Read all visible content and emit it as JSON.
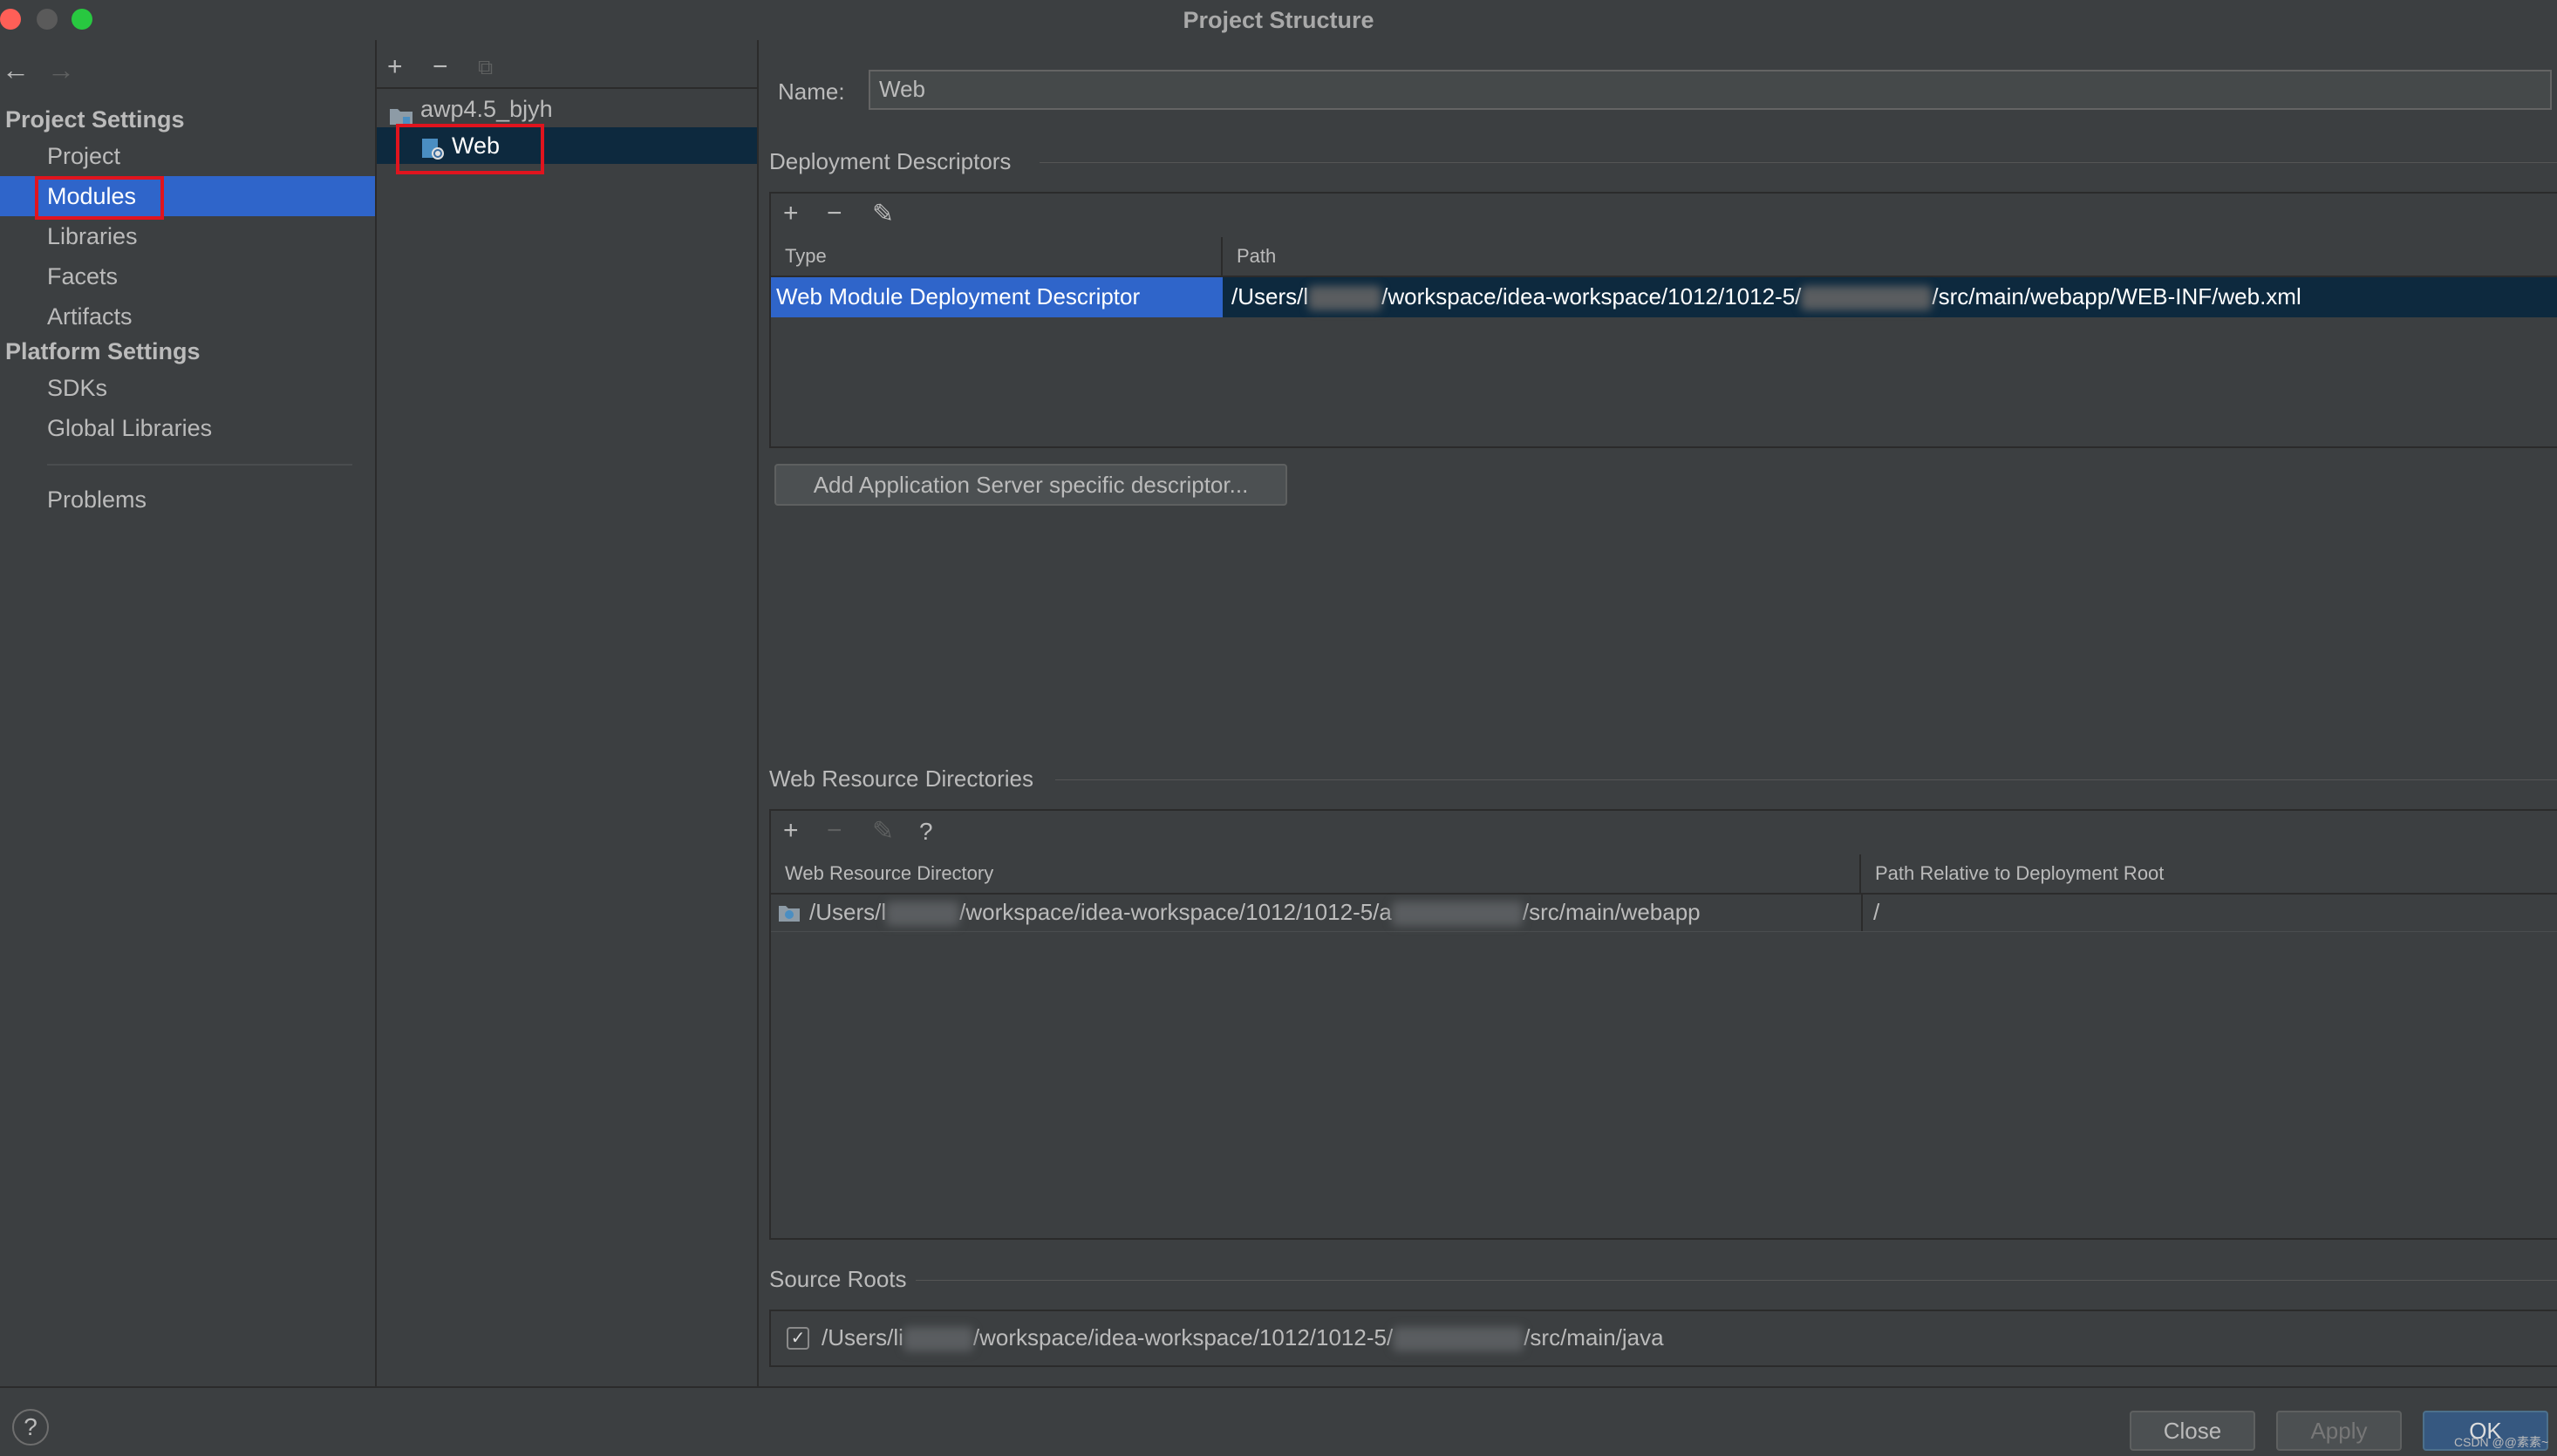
{
  "window": {
    "title": "Project Structure",
    "traffic_light_colors": [
      "#ff5f57",
      "#5a5a5a",
      "#28c840"
    ]
  },
  "nav": {
    "back": "←",
    "forward": "→"
  },
  "sidebar": {
    "project_settings_heading": "Project Settings",
    "project_settings_items": [
      "Project",
      "Modules",
      "Libraries",
      "Facets",
      "Artifacts"
    ],
    "platform_settings_heading": "Platform Settings",
    "platform_settings_items": [
      "SDKs",
      "Global Libraries"
    ],
    "problems": "Problems",
    "selected": "Modules"
  },
  "tree": {
    "toolbar": {
      "add": "+",
      "remove": "−",
      "copy": "⧉"
    },
    "root": "awp4.5_bjyh",
    "child": "Web"
  },
  "main": {
    "name_label": "Name:",
    "name_value": "Web",
    "deployment_descriptors": {
      "title": "Deployment Descriptors",
      "toolbar": {
        "add": "+",
        "remove": "−",
        "edit": "✎"
      },
      "columns": [
        "Type",
        "Path"
      ],
      "row": {
        "type": "Web Module Deployment Descriptor",
        "path_prefix": "/Users/l",
        "path_middle": "/workspace/idea-workspace/1012/1012-5/",
        "path_suffix": "/src/main/webapp/WEB-INF/web.xml"
      },
      "add_server_button": "Add Application Server specific descriptor..."
    },
    "web_resource_directories": {
      "title": "Web Resource Directories",
      "toolbar": {
        "add": "+",
        "remove": "−",
        "edit": "✎",
        "help": "?"
      },
      "columns": [
        "Web Resource Directory",
        "Path Relative to Deployment Root"
      ],
      "row": {
        "dir_prefix": "/Users/l",
        "dir_middle": "/workspace/idea-workspace/1012/1012-5/a",
        "dir_suffix": "/src/main/webapp",
        "relative": "/"
      }
    },
    "source_roots": {
      "title": "Source Roots",
      "checked": true,
      "check_glyph": "✓",
      "path_prefix": "/Users/li",
      "path_middle": "/workspace/idea-workspace/1012/1012-5/",
      "path_suffix": "/src/main/java"
    }
  },
  "footer": {
    "help": "?",
    "close": "Close",
    "apply": "Apply",
    "ok": "OK",
    "watermark": "CSDN @@素素~"
  },
  "colors": {
    "selection": "#2f65ca",
    "highlight_box": "#e0141e",
    "tree_selection": "#0d293e",
    "ok_button": "#365880"
  }
}
